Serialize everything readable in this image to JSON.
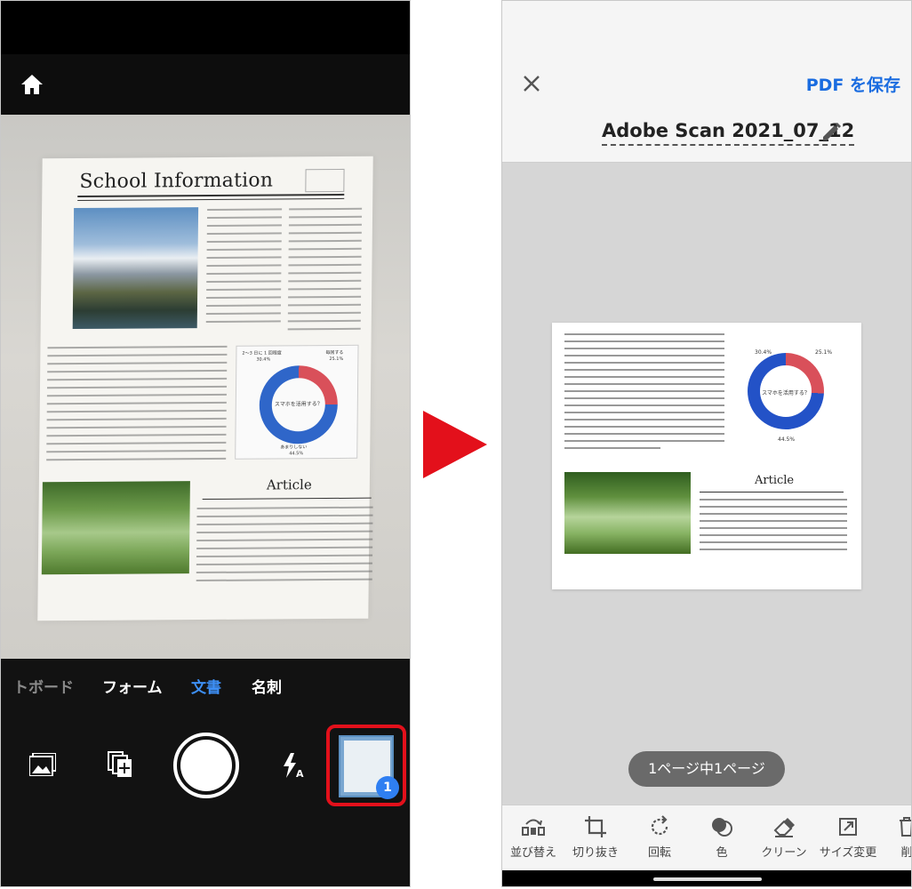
{
  "left_screen": {
    "paper": {
      "title": "School Information",
      "article_heading": "Article",
      "chart_question": "スマホを活用する？",
      "chart_pct_top": "30.4%",
      "chart_pct_right": "25.1%",
      "chart_pct_bottom": "44.5%",
      "chart_label_left": "2～3 日に 1 回程度",
      "chart_label_right": "毎回する",
      "chart_label_bottom": "あまりしない"
    },
    "modes": [
      "トボード",
      "フォーム",
      "文書",
      "名刺"
    ],
    "active_mode": "文書",
    "thumbnail_badge": "1"
  },
  "right_screen": {
    "save_label": "PDF を保存",
    "document_title": "Adobe Scan 2021_07_12",
    "preview": {
      "chart_question": "スマホを活用する？",
      "chart_pct_top": "30.4%",
      "chart_pct_right": "25.1%",
      "chart_pct_bottom": "44.5%",
      "article_heading": "Article"
    },
    "page_indicator": "1ページ中1ページ",
    "tools": [
      {
        "label": "並び替え",
        "icon": "reorder-icon"
      },
      {
        "label": "切り抜き",
        "icon": "crop-icon"
      },
      {
        "label": "回転",
        "icon": "rotate-icon"
      },
      {
        "label": "色",
        "icon": "color-icon"
      },
      {
        "label": "クリーン",
        "icon": "eraser-icon"
      },
      {
        "label": "サイズ変更",
        "icon": "resize-icon"
      },
      {
        "label": "削",
        "icon": "trash-icon"
      }
    ]
  },
  "colors": {
    "accent_blue": "#1a6ce0",
    "highlight_red": "#e3101b",
    "donut_red": "#d9505a",
    "donut_blue": "#2f66c9"
  }
}
